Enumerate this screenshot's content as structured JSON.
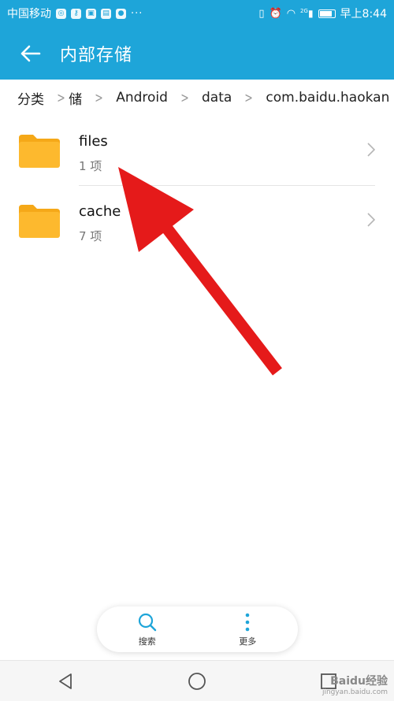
{
  "status_bar": {
    "carrier": "中国移动",
    "time": "早上8:44",
    "signal_label": "2G"
  },
  "header": {
    "title": "内部存储"
  },
  "breadcrumb": {
    "items": [
      "分类",
      "储",
      "Android",
      "data",
      "com.baidu.haokan"
    ]
  },
  "files": [
    {
      "name": "files",
      "count": "1 项"
    },
    {
      "name": "cache",
      "count": "7 项"
    }
  ],
  "bottom_actions": {
    "search_label": "搜索",
    "more_label": "更多"
  },
  "watermark": {
    "line1": "Baidu经验",
    "line2": "jingyan.baidu.com"
  },
  "colors": {
    "accent": "#1ea5d9",
    "folder": "#fdb92e",
    "annotation_arrow": "#e51a1a"
  },
  "icons": [
    "back-arrow-icon",
    "folder-icon",
    "chevron-right-icon",
    "search-icon",
    "more-icon",
    "back-nav-icon",
    "home-nav-icon",
    "recents-nav-icon"
  ]
}
